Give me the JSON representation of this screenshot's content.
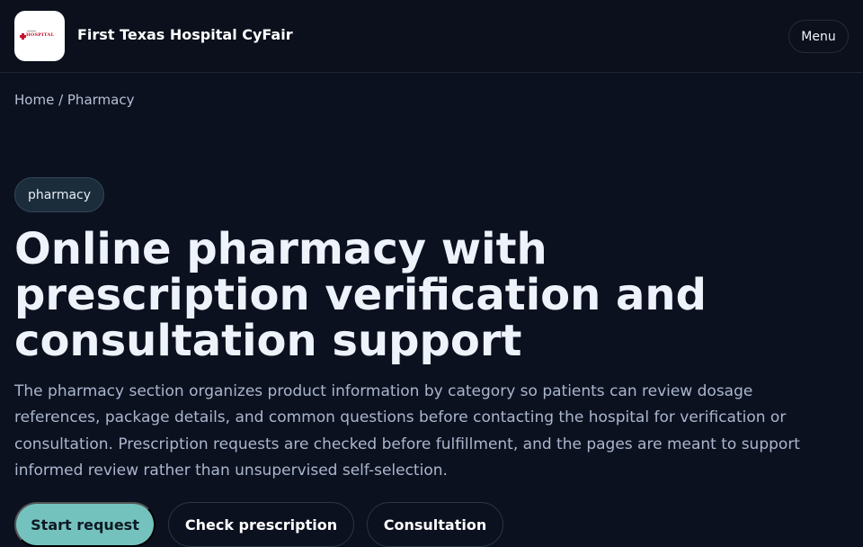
{
  "header": {
    "site_name": "First Texas Hospital CyFair",
    "logo_text": "HOSPITAL",
    "menu_label": "Menu"
  },
  "breadcrumb": "Home / Pharmacy",
  "badge": "pharmacy",
  "hero": {
    "title": "Online pharmacy with prescription verification and consultation support",
    "description": "The pharmacy section organizes product information by category so patients can review dosage references, package details, and common questions before contacting the hospital for verification or consultation. Prescription requests are checked before fulfillment, and the pages are meant to support informed review rather than unsupervised self-selection."
  },
  "actions": {
    "start_request": "Start request",
    "check_prescription": "Check prescription",
    "consultation": "Consultation"
  },
  "colors": {
    "background": "#0c1120",
    "primary_button": "#74c2be",
    "logo_red": "#c8102e"
  }
}
